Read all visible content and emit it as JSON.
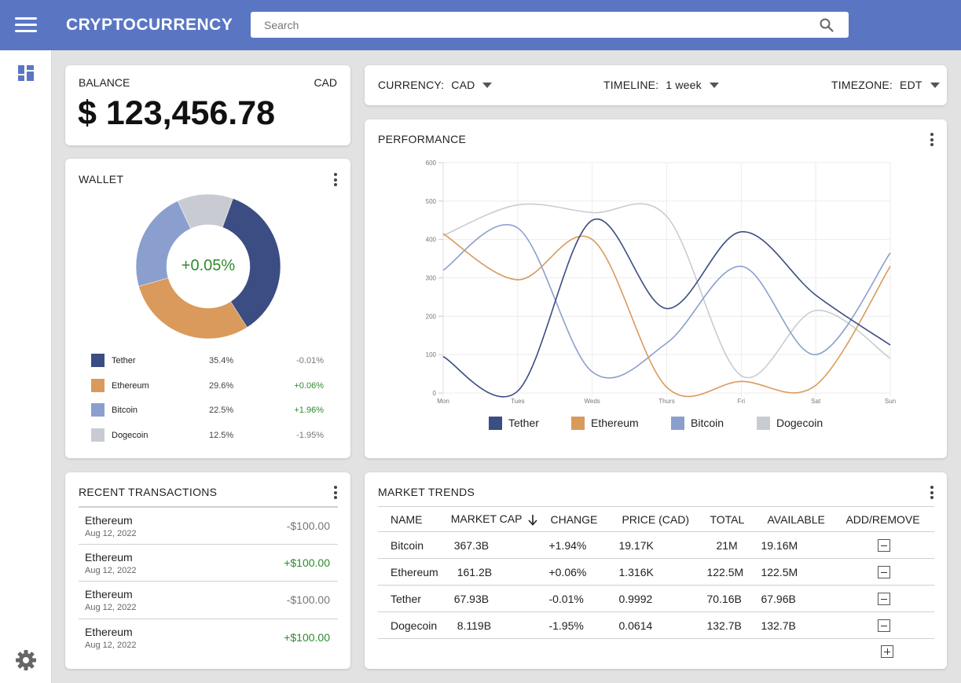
{
  "app": {
    "title": "CRYPTOCURRENCY"
  },
  "search": {
    "placeholder": "Search"
  },
  "colors": {
    "topbar": "#5a76c3",
    "positive": "#2e8a2e",
    "neutral": "#777777"
  },
  "icons": {
    "menu": "menu-icon",
    "search": "search-icon",
    "dashboard": "dashboard-icon",
    "settings": "gear-icon",
    "more": "kebab-icon"
  },
  "balance": {
    "label": "BALANCE",
    "currency": "CAD",
    "amount": "$ 123,456.78"
  },
  "wallet": {
    "title": "WALLET",
    "center_change": "+0.05%",
    "items": [
      {
        "name": "Tether",
        "percent": "35.4%",
        "change": "-0.01%",
        "color": "#3b4d83",
        "share": 35.4,
        "trend": "neg"
      },
      {
        "name": "Ethereum",
        "percent": "29.6%",
        "change": "+0.06%",
        "color": "#d99a5c",
        "share": 29.6,
        "trend": "pos"
      },
      {
        "name": "Bitcoin",
        "percent": "22.5%",
        "change": "+1.96%",
        "color": "#8b9fce",
        "share": 22.5,
        "trend": "pos"
      },
      {
        "name": "Dogecoin",
        "percent": "12.5%",
        "change": "-1.95%",
        "color": "#c8ccd2",
        "share": 12.5,
        "trend": "neg"
      }
    ]
  },
  "filters": {
    "currency": {
      "label": "CURRENCY:",
      "value": "CAD"
    },
    "timeline": {
      "label": "TIMELINE:",
      "value": "1 week"
    },
    "timezone": {
      "label": "TIMEZONE:",
      "value": "EDT"
    }
  },
  "performance": {
    "title": "PERFORMANCE"
  },
  "chart_data": {
    "type": "line",
    "title": "PERFORMANCE",
    "x": [
      "Mon",
      "Tues",
      "Weds",
      "Thurs",
      "Fri",
      "Sat",
      "Sun"
    ],
    "ylim": [
      0,
      600
    ],
    "yticks": [
      0,
      100,
      200,
      300,
      400,
      500,
      600
    ],
    "grid": true,
    "legend": "bottom",
    "series": [
      {
        "name": "Tether",
        "color": "#3b4d83",
        "values": [
          95,
          5,
          450,
          220,
          420,
          255,
          125
        ]
      },
      {
        "name": "Ethereum",
        "color": "#d99a5c",
        "values": [
          415,
          295,
          400,
          15,
          30,
          20,
          330
        ]
      },
      {
        "name": "Bitcoin",
        "color": "#8b9fce",
        "values": [
          320,
          430,
          55,
          130,
          330,
          100,
          365
        ]
      },
      {
        "name": "Dogecoin",
        "color": "#c8ccd2",
        "values": [
          410,
          490,
          470,
          460,
          45,
          215,
          90
        ]
      }
    ]
  },
  "transactions": {
    "title": "RECENT TRANSACTIONS",
    "items": [
      {
        "name": "Ethereum",
        "date": "Aug 12, 2022",
        "amount": "-$100.00",
        "trend": "neg"
      },
      {
        "name": "Ethereum",
        "date": "Aug 12, 2022",
        "amount": "+$100.00",
        "trend": "pos"
      },
      {
        "name": "Ethereum",
        "date": "Aug 12, 2022",
        "amount": "-$100.00",
        "trend": "neg"
      },
      {
        "name": "Ethereum",
        "date": "Aug 12, 2022",
        "amount": "+$100.00",
        "trend": "pos"
      }
    ]
  },
  "market": {
    "title": "MARKET TRENDS",
    "columns": [
      "NAME",
      "MARKET CAP",
      "CHANGE",
      "PRICE (CAD)",
      "TOTAL",
      "AVAILABLE",
      "ADD/REMOVE"
    ],
    "rows": [
      {
        "name": "Bitcoin",
        "market_cap": "367.3B",
        "change": "+1.94%",
        "price": "19.17K",
        "total": "21M",
        "available": "19.16M",
        "trend": "pos"
      },
      {
        "name": "Ethereum",
        "market_cap": "161.2B",
        "change": "+0.06%",
        "price": "1.316K",
        "total": "122.5M",
        "available": "122.5M",
        "trend": "pos"
      },
      {
        "name": "Tether",
        "market_cap": "67.93B",
        "change": "-0.01%",
        "price": "0.9992",
        "total": "70.16B",
        "available": "67.96B",
        "trend": "neg"
      },
      {
        "name": "Dogecoin",
        "market_cap": "8.119B",
        "change": "-1.95%",
        "price": "0.0614",
        "total": "132.7B",
        "available": "132.7B",
        "trend": "neg"
      }
    ]
  }
}
